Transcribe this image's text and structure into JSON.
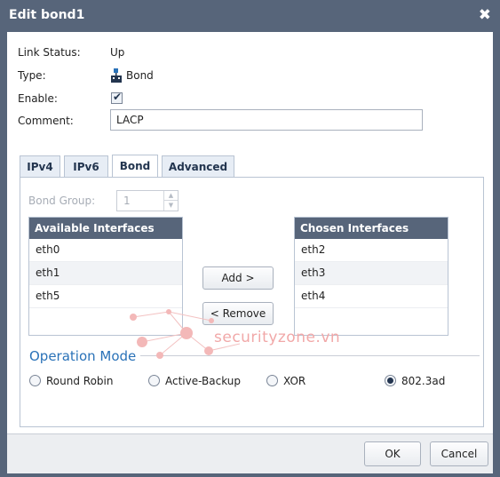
{
  "window": {
    "title": "Edit bond1",
    "close_glyph": "✖"
  },
  "fields": {
    "link_status": {
      "label": "Link Status:",
      "value": "Up"
    },
    "type": {
      "label": "Type:",
      "value": "Bond",
      "icon": "bond-icon"
    },
    "enable": {
      "label": "Enable:",
      "checked": true,
      "check_glyph": "✔"
    },
    "comment": {
      "label": "Comment:",
      "value": "LACP"
    }
  },
  "tabs": [
    {
      "label": "IPv4",
      "active": false
    },
    {
      "label": "IPv6",
      "active": false
    },
    {
      "label": "Bond",
      "active": true
    },
    {
      "label": "Advanced",
      "active": false
    }
  ],
  "bond": {
    "group_label": "Bond Group:",
    "group_value": "1",
    "available": {
      "title": "Available Interfaces",
      "items": [
        "eth0",
        "eth1",
        "eth5"
      ]
    },
    "chosen": {
      "title": "Chosen Interfaces",
      "items": [
        "eth2",
        "eth3",
        "eth4"
      ]
    },
    "add_label": "Add >",
    "remove_label": "< Remove"
  },
  "operation_mode": {
    "title": "Operation Mode",
    "options": [
      {
        "label": "Round Robin",
        "checked": false
      },
      {
        "label": "Active-Backup",
        "checked": false
      },
      {
        "label": "XOR",
        "checked": false
      },
      {
        "label": "802.3ad",
        "checked": true
      }
    ]
  },
  "watermark": {
    "text": "securityzone.vn"
  },
  "footer": {
    "ok_label": "OK",
    "cancel_label": "Cancel"
  },
  "colors": {
    "titlebar": "#57657a",
    "accent": "#2a72b8",
    "watermark": "#f1a8a8"
  }
}
